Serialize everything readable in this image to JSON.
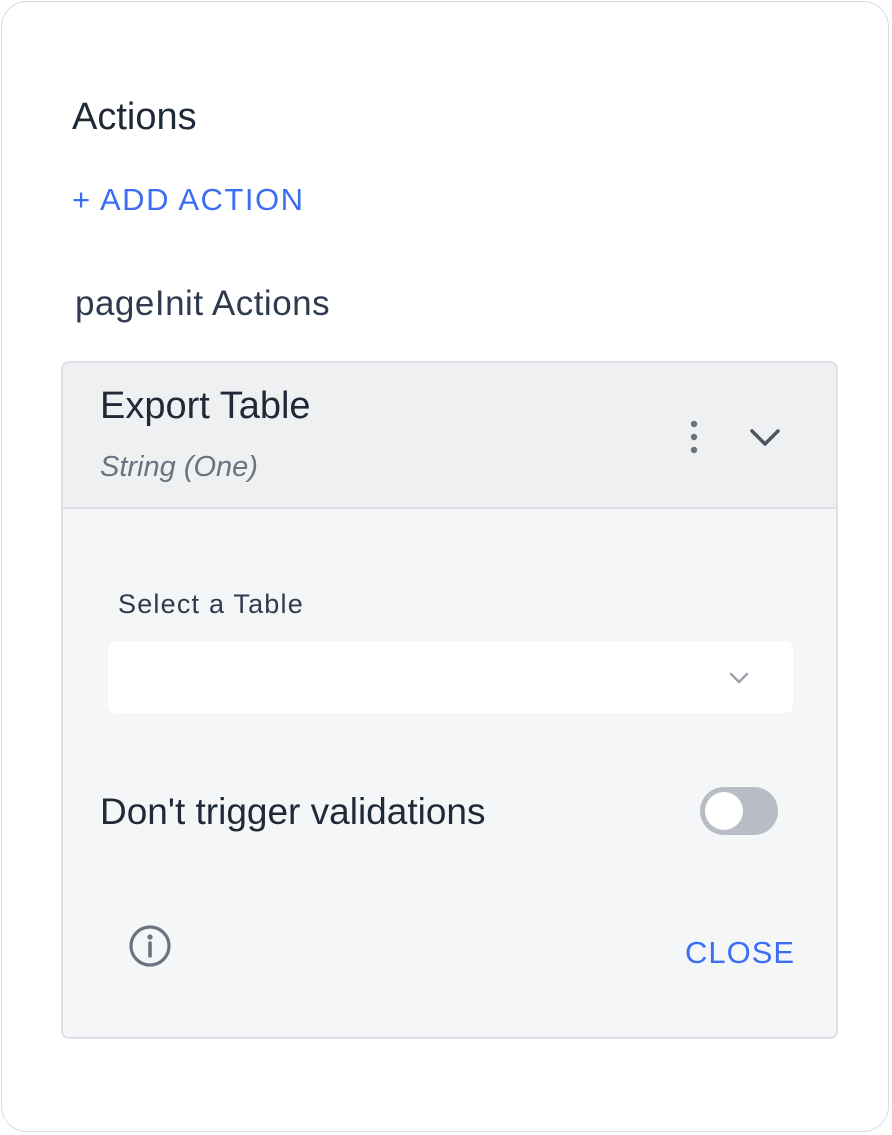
{
  "panel": {
    "title": "Actions",
    "add_action_label": "+ ADD ACTION",
    "section_title": "pageInit Actions"
  },
  "action_card": {
    "title": "Export Table",
    "subtitle": "String (One)",
    "menu_icon": "kebab-vertical-icon",
    "expand_icon": "chevron-down-icon",
    "table_field": {
      "label": "Select a Table",
      "value": ""
    },
    "validation_toggle": {
      "label": "Don't trigger validations",
      "checked": false
    },
    "info_icon": "info-circle-icon",
    "close_label": "CLOSE"
  },
  "colors": {
    "accent": "#3b6ef5",
    "card_bg": "#f5f6f8",
    "header_bg": "#eff0f2",
    "toggle_off": "#b7bcc5"
  }
}
